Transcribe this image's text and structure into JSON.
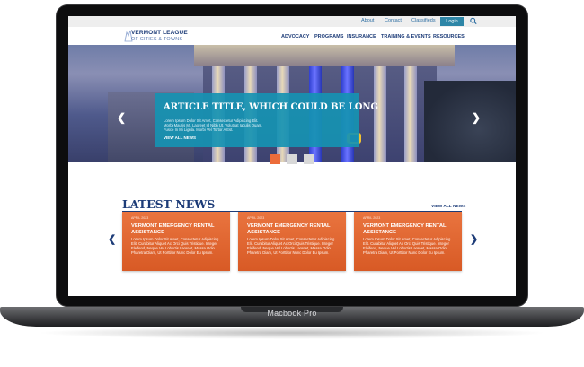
{
  "device": {
    "label": "Macbook Pro"
  },
  "utility_bar": {
    "links": [
      "About",
      "Contact",
      "Classifieds"
    ],
    "login_label": "Login",
    "search_icon": "search-icon"
  },
  "header": {
    "logo_line1": "VERMONT LEAGUE",
    "logo_line2": "OF CITIES & TOWNS",
    "nav": [
      "ADVOCACY",
      "PROGRAMS",
      "INSURANCE",
      "TRAINING & EVENTS",
      "RESOURCES"
    ]
  },
  "hero": {
    "title": "ARTICLE TITLE, WHICH COULD BE LONG",
    "body": "Lorem Ipsum Dolor Sit Amet, Consectetur Adipiscing Elit. Morbi Mauris Mi, Laoreet Id Nibh Ut, Volutpat Iaculis Quam. Fusce In Mi Ligula. Morbi Vel Tortor A Est.",
    "link": "VIEW ALL NEWS",
    "slides": 3,
    "active_slide": 1
  },
  "news": {
    "title": "LATEST NEWS",
    "view_all": "VIEW ALL NEWS",
    "cards": [
      {
        "date": "APRIL 2023",
        "title": "VERMONT EMERGENCY RENTAL ASSISTANCE",
        "body": "Lorem Ipsum Dolor Sit Amet, Consectetur Adipiscing Elit. Curabitur Aliquet Ac Orci Quis Tristique. Integer Eleifend, Neque Vel Lobortis Laoreet, Massa Odio Pharetra Diam, Ut Porttitor Nunc Dolor Eu Ipsum."
      },
      {
        "date": "APRIL 2023",
        "title": "VERMONT EMERGENCY RENTAL ASSISTANCE",
        "body": "Lorem Ipsum Dolor Sit Amet, Consectetur Adipiscing Elit. Curabitur Aliquet Ac Orci Quis Tristique. Integer Eleifend, Neque Vel Lobortis Laoreet, Massa Odio Pharetra Diam, Ut Porttitor Nunc Dolor Eu Ipsum."
      },
      {
        "date": "APRIL 2023",
        "title": "VERMONT EMERGENCY RENTAL ASSISTANCE",
        "body": "Lorem Ipsum Dolor Sit Amet, Consectetur Adipiscing Elit. Curabitur Aliquet Ac Orci Quis Tristique. Integer Eleifend, Neque Vel Lobortis Laoreet, Massa Odio Pharetra Diam, Ut Porttitor Nunc Dolor Eu Ipsum."
      }
    ]
  },
  "colors": {
    "brand_navy": "#1d3c78",
    "accent_teal": "#1692b2",
    "accent_orange": "#e9743f",
    "login_blue": "#2e86a7"
  },
  "icons": {
    "prev": "chevron-left-icon",
    "next": "chevron-right-icon",
    "logo": "logo-mark-icon"
  }
}
